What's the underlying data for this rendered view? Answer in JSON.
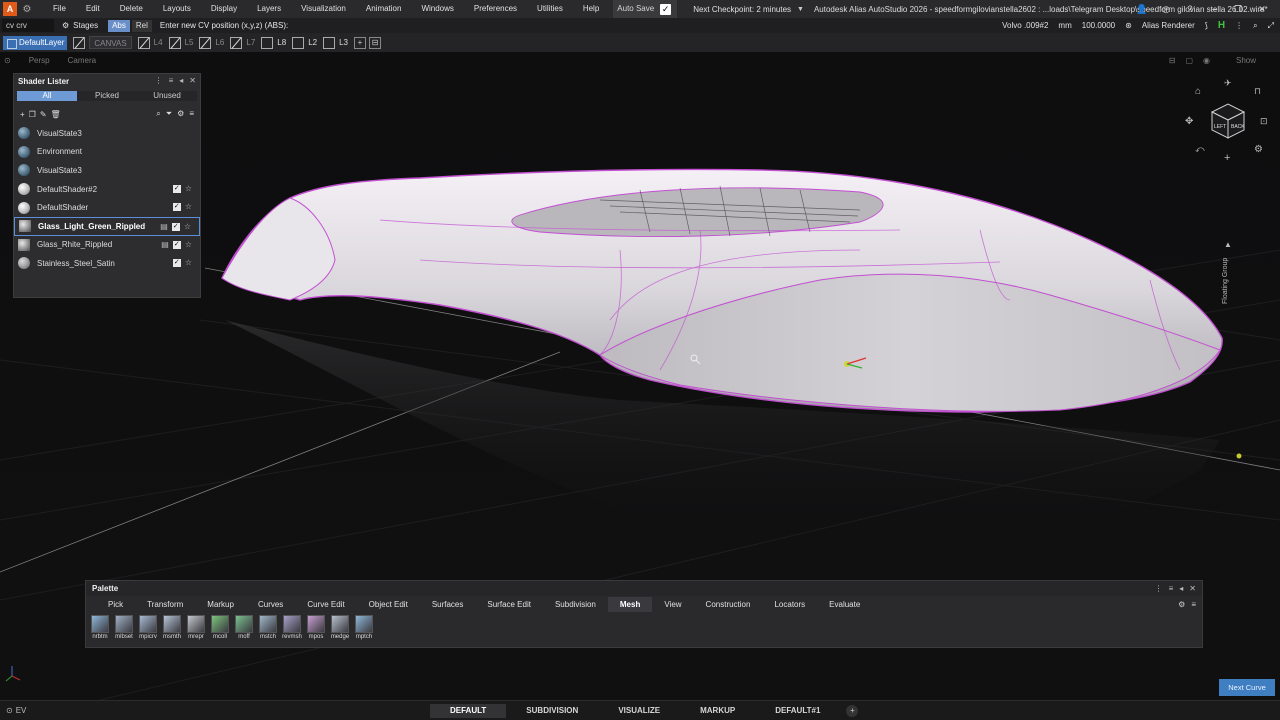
{
  "menubar": {
    "items": [
      "File",
      "Edit",
      "Delete",
      "Layouts",
      "Display",
      "Layers",
      "Visualization",
      "Animation",
      "Windows",
      "Preferences",
      "Utilities",
      "Help"
    ],
    "autosave_label": "Auto Save",
    "checkpoint": "Next Checkpoint: 2 minutes",
    "window_title": "Autodesk Alias AutoStudio 2026   - speedformgilovianstella2602 : ...loads\\Telegram Desktop\\speedform gilovian stella 26.02.wire*"
  },
  "promptbar": {
    "cv_field": "cv crv",
    "stages_label": "Stages",
    "abs_label": "Abs",
    "rel_label": "Rel",
    "prompt": "Enter new CV position (x,y,z) (ABS):",
    "model_name": "Volvo .009#2",
    "units": "mm",
    "scale": "100.0000",
    "renderer": "Alias Renderer"
  },
  "layerbar": {
    "default_layer": "DefaultLayer",
    "canvas": "CANVAS",
    "layers": [
      "L4",
      "L5",
      "L6",
      "L7",
      "L8",
      "L2",
      "L3"
    ]
  },
  "viewport": {
    "view_name": "Persp",
    "camera_label": "Camera",
    "show_label": "Show"
  },
  "shader_lister": {
    "title": "Shader Lister",
    "tabs": [
      "All",
      "Picked",
      "Unused"
    ],
    "items": [
      {
        "name": "VisualState3",
        "kind": "env"
      },
      {
        "name": "Environment",
        "kind": "env"
      },
      {
        "name": "VisualState3",
        "kind": "env"
      },
      {
        "name": "DefaultShader#2",
        "kind": "white"
      },
      {
        "name": "DefaultShader",
        "kind": "white"
      },
      {
        "name": "Glass_Light_Green_Rippled",
        "kind": "glass"
      },
      {
        "name": "Glass_Rhite_Rippled",
        "kind": "glass"
      },
      {
        "name": "Stainless_Steel_Satin",
        "kind": "steel"
      }
    ]
  },
  "viewcube": {
    "left": "LEFT",
    "back": "BACK"
  },
  "floating_group": "Floating Group",
  "palette": {
    "title": "Palette",
    "tabs": [
      "Pick",
      "Transform",
      "Markup",
      "Curves",
      "Curve Edit",
      "Object Edit",
      "Surfaces",
      "Surface Edit",
      "Subdivision",
      "Mesh",
      "View",
      "Construction",
      "Locators",
      "Evaluate"
    ],
    "active_tab": "Mesh",
    "tools": [
      "nrbtm",
      "mlbset",
      "mpicrv",
      "msmth",
      "mrepr",
      "mcoll",
      "moff",
      "mstch",
      "revmsh",
      "mpos",
      "medge",
      "mptch"
    ]
  },
  "next_curve": "Next Curve",
  "bottombar": {
    "ev_label": "EV",
    "workspaces": [
      "DEFAULT",
      "SUBDIVISION",
      "VISUALIZE",
      "MARKUP",
      "DEFAULT#1"
    ],
    "active_workspace": "DEFAULT"
  }
}
